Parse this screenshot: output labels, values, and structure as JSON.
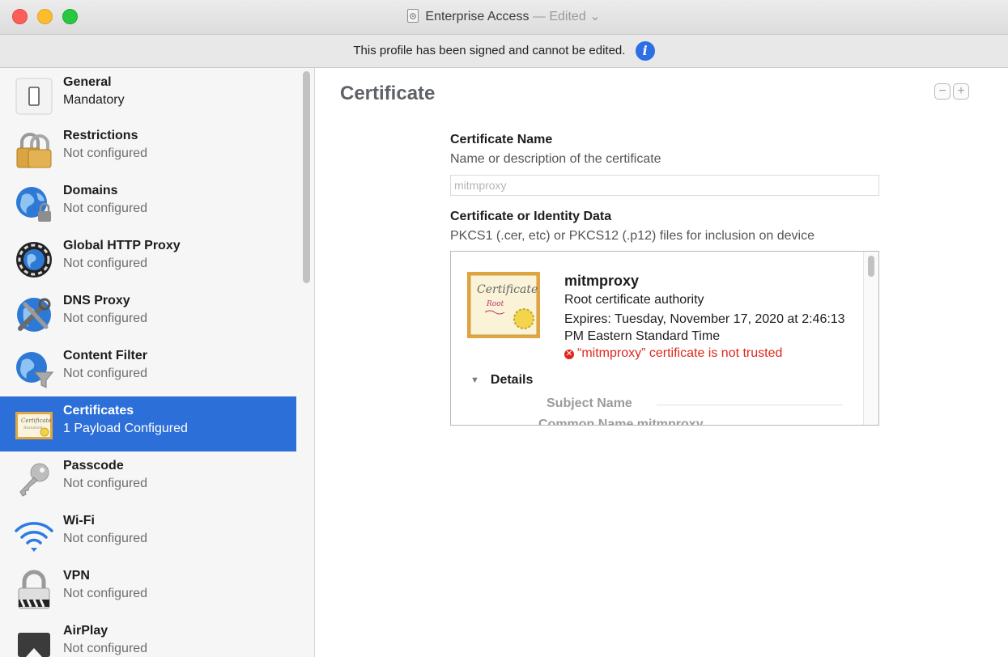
{
  "window": {
    "title": "Enterprise Access",
    "separator": "—",
    "status": "Edited",
    "status_chevron": "⌄"
  },
  "banner": {
    "text": "This profile has been signed and cannot be edited.",
    "icon": "info-icon",
    "icon_glyph": "i"
  },
  "sidebar": {
    "items": [
      {
        "name": "General",
        "subtitle": "Mandatory",
        "icon": "general-icon"
      },
      {
        "name": "Restrictions",
        "subtitle": "Not configured",
        "icon": "restrictions-lock-icon"
      },
      {
        "name": "Domains",
        "subtitle": "Not configured",
        "icon": "domains-globe-icon"
      },
      {
        "name": "Global HTTP Proxy",
        "subtitle": "Not configured",
        "icon": "global-proxy-icon"
      },
      {
        "name": "DNS Proxy",
        "subtitle": "Not configured",
        "icon": "dns-proxy-icon"
      },
      {
        "name": "Content Filter",
        "subtitle": "Not configured",
        "icon": "content-filter-icon"
      },
      {
        "name": "Certificates",
        "subtitle": "1 Payload Configured",
        "icon": "certificate-icon",
        "selected": true
      },
      {
        "name": "Passcode",
        "subtitle": "Not configured",
        "icon": "key-icon"
      },
      {
        "name": "Wi-Fi",
        "subtitle": "Not configured",
        "icon": "wifi-icon"
      },
      {
        "name": "VPN",
        "subtitle": "Not configured",
        "icon": "vpn-lock-icon"
      },
      {
        "name": "AirPlay",
        "subtitle": "Not configured",
        "icon": "airplay-icon"
      }
    ]
  },
  "main": {
    "title": "Certificate",
    "minus_label": "−",
    "plus_label": "+",
    "cert_name_label": "Certificate Name",
    "cert_name_help": "Name or description of the certificate",
    "cert_name_value": "mitmproxy",
    "identity_label": "Certificate or Identity Data",
    "identity_help": "PKCS1 (.cer, etc) or PKCS12 (.p12) files for inclusion on device",
    "cert": {
      "name": "mitmproxy",
      "type": "Root certificate authority",
      "expires": "Expires: Tuesday, November 17, 2020 at 2:46:13 PM Eastern Standard Time",
      "warning": "“mitmproxy” certificate is not trusted",
      "details_label": "Details",
      "subject_name_label": "Subject Name",
      "common_name_row": "Common Name   mitmproxy"
    }
  },
  "colors": {
    "selection": "#2c6fd9",
    "warning": "#e0271d",
    "info": "#2f6fe4"
  }
}
